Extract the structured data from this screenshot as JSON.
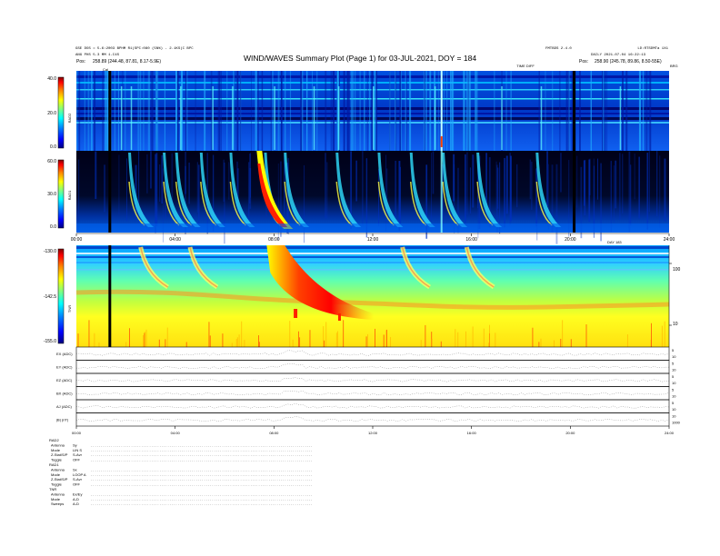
{
  "header": {
    "title": "WIND/WAVES Summary Plot (Page 1) for 03-JUL-2021, DOY = 184",
    "left_line1": "GSE DOS = 5-6:2003 BPHM R1(SPC:080 (5N%) - 2.1KS)C BPC",
    "left_line2": "ANG PHS 5.3 MM 1-C4S",
    "left_line3_label": "Pos:",
    "left_line3_value": "258.89 (244.48, 87.81, 8.17-5.9E)",
    "right_top_left": "FMTBDS 2.4.0",
    "right_top_right": "LD:RTSDMTa 1X1",
    "right_line2": "DAILY 2021-07-04 16:22:13",
    "right_line3_label": "Pos:",
    "right_line3_value": "258.90 (245.78, 89.86, 8.50-55E)",
    "sub_center": "TIME DIFF",
    "sub_right": "BRG"
  },
  "panels": [
    {
      "name": "RAD2",
      "ticks": [
        "40.0",
        "20.0",
        "0.0"
      ],
      "ymin": 0,
      "ymax": 40
    },
    {
      "name": "RAD1",
      "ticks": [
        "60.0",
        "30.0",
        "0.0"
      ],
      "ymin": 0,
      "ymax": 60
    },
    {
      "name": "TNR",
      "ticks": [
        "-130.0",
        "-142.5",
        "-155.0"
      ],
      "ymin": -155,
      "ymax": -130,
      "right_ticks": [
        "100",
        "10"
      ]
    }
  ],
  "cal_label": "Cal",
  "time_axis": {
    "labels": [
      "00:00",
      "04:00",
      "08:00",
      "12:00",
      "16:00",
      "20:00",
      "24:00"
    ],
    "right_label": "DAY 183"
  },
  "line_panels": [
    {
      "name": "EX (ADC)",
      "right_ticks": [
        "5",
        "10"
      ]
    },
    {
      "name": "EY (ADC)",
      "right_ticks": [
        "5",
        "10"
      ]
    },
    {
      "name": "EZ (ADC)",
      "right_ticks": [
        "5",
        "10"
      ]
    },
    {
      "name": "BX (ADC)",
      "right_ticks": [
        "5",
        "10"
      ]
    },
    {
      "name": "AJ (ADC)",
      "right_ticks": [
        "5",
        "10"
      ]
    },
    {
      "name": "|B| (nT)",
      "right_ticks": [
        "10",
        "1000"
      ]
    }
  ],
  "bottom_time_axis": {
    "labels": [
      "00:00",
      "04:00",
      "08:00",
      "12:00",
      "16:00",
      "20:00",
      "24:00"
    ]
  },
  "status_block": {
    "groups": [
      {
        "title": "RAD2",
        "rows": [
          {
            "label": "Antenna",
            "value": "Sy"
          },
          {
            "label": "Mode",
            "value": "LIN S"
          },
          {
            "label": "Z-Stat/S/P",
            "value": "S-Avr"
          },
          {
            "label": "Toggle",
            "value": "OFF"
          }
        ]
      },
      {
        "title": "RAD1",
        "rows": [
          {
            "label": "Antenna",
            "value": "Sx"
          },
          {
            "label": "Mode",
            "value": "LOOP A"
          },
          {
            "label": "Z-Stat/S/P",
            "value": "S-Avr"
          },
          {
            "label": "Toggle",
            "value": "OFF"
          }
        ]
      },
      {
        "title": "TNR",
        "rows": [
          {
            "label": "Antenna",
            "value": "Ex/Ey"
          },
          {
            "label": "Mode",
            "value": "A-D"
          },
          {
            "label": "Sweeps",
            "value": "A-D"
          }
        ]
      }
    ]
  },
  "colors": {
    "colorbar": [
      "#000080",
      "#0000ff",
      "#0080ff",
      "#00ffff",
      "#80ff80",
      "#ffff00",
      "#ff8000",
      "#ff0000",
      "#800000"
    ],
    "rad_background": "#0030c0",
    "tnr_background": "#ffee20"
  },
  "chart_data": [
    {
      "type": "heatmap",
      "title": "WIND/WAVES Summary Plot (Page 1) for 03-JUL-2021, DOY = 184",
      "panel": "RAD2",
      "xlabel": "",
      "ylabel": "RAD2",
      "xlim": [
        0,
        24
      ],
      "ylim": [
        0,
        40
      ],
      "events_hours": [
        1.8,
        2.2,
        4.2,
        5.5,
        6.3,
        8.0,
        9.6,
        10.6,
        12.0,
        14.5,
        17.2,
        18.8,
        22.0
      ],
      "black_lines_hours": [
        1.3,
        20.1
      ],
      "grid": false
    },
    {
      "type": "heatmap",
      "panel": "RAD1",
      "xlabel": "",
      "ylabel": "RAD1",
      "xlim": [
        0,
        24
      ],
      "ylim": [
        0,
        60
      ],
      "events_hours": [
        2.1,
        3.5,
        4.0,
        5.0,
        6.2,
        7.6,
        8.4,
        10.5,
        12.2,
        13.5,
        14.8,
        16.2,
        18.6
      ],
      "strong_event_hours": [
        7.3,
        8.5
      ],
      "grid": false
    },
    {
      "type": "heatmap",
      "panel": "TNR",
      "xlabel": "",
      "ylabel": "TNR",
      "xlim": [
        0,
        24
      ],
      "ylim": [
        -155,
        -130
      ],
      "events_hours": [
        2.6,
        4.6,
        8.0,
        13.2,
        15.8
      ],
      "strong_event_hours": [
        8.0,
        10.2
      ],
      "grid": false
    }
  ]
}
